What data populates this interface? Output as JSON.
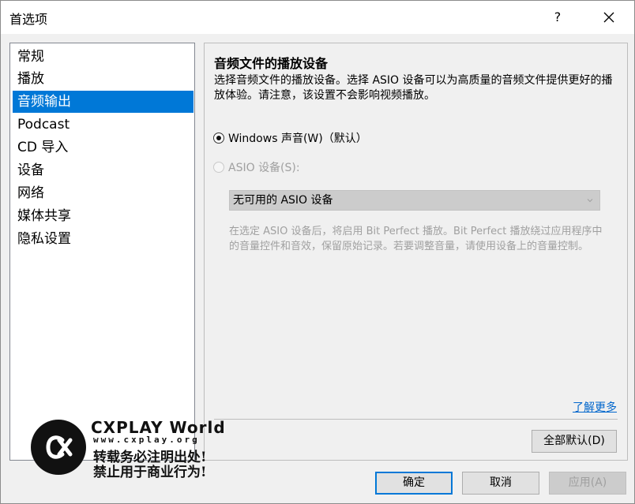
{
  "window": {
    "title": "首选项",
    "help_label": "?"
  },
  "sidebar": {
    "items": [
      {
        "label": "常规",
        "selected": false
      },
      {
        "label": "播放",
        "selected": false
      },
      {
        "label": "音频输出",
        "selected": true
      },
      {
        "label": "Podcast",
        "selected": false
      },
      {
        "label": "CD 导入",
        "selected": false
      },
      {
        "label": "设备",
        "selected": false
      },
      {
        "label": "网络",
        "selected": false
      },
      {
        "label": "媒体共享",
        "selected": false
      },
      {
        "label": "隐私设置",
        "selected": false
      }
    ]
  },
  "panel": {
    "title": "音频文件的播放设备",
    "description": "选择音频文件的播放设备。选择 ASIO 设备可以为高质量的音频文件提供更好的播放体验。请注意，该设置不会影响视频播放。",
    "radio_windows": {
      "label": "Windows 声音(W)（默认）",
      "checked": true
    },
    "radio_asio": {
      "label": "ASIO 设备(S):",
      "checked": false,
      "enabled": false
    },
    "asio_select": {
      "value": "无可用的 ASIO 设备",
      "enabled": false
    },
    "asio_note": "在选定 ASIO 设备后，将启用 Bit Perfect 播放。Bit Perfect 播放绕过应用程序中的音量控件和音效，保留原始记录。若要调整音量，请使用设备上的音量控制。",
    "learn_more": "了解更多",
    "reset_button": "全部默认(D)"
  },
  "footer": {
    "ok": "确定",
    "cancel": "取消",
    "apply": "应用(A)"
  },
  "watermark": {
    "brand": "CXPLAY World",
    "url": "www.cxplay.org",
    "line1": "转载务必注明出处!",
    "line2": "禁止用于商业行为!"
  },
  "colors": {
    "accent": "#0078d7",
    "link": "#0066cc"
  }
}
